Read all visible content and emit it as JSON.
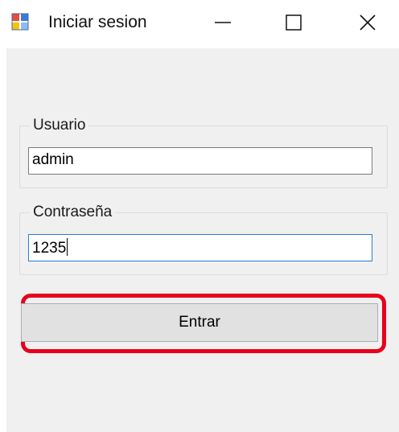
{
  "window": {
    "title": "Iniciar sesion",
    "icon": "windows-form-icon",
    "controls": {
      "minimize_icon": "minimize-icon",
      "maximize_icon": "maximize-icon",
      "close_icon": "close-icon"
    }
  },
  "form": {
    "user_group_label": "Usuario",
    "user_value": "admin",
    "password_group_label": "Contraseña",
    "password_value": "1235",
    "submit_label": "Entrar"
  },
  "colors": {
    "highlight": "#e8001c",
    "focus_border": "#2a7bd6",
    "client_background": "#f0f0f0"
  }
}
